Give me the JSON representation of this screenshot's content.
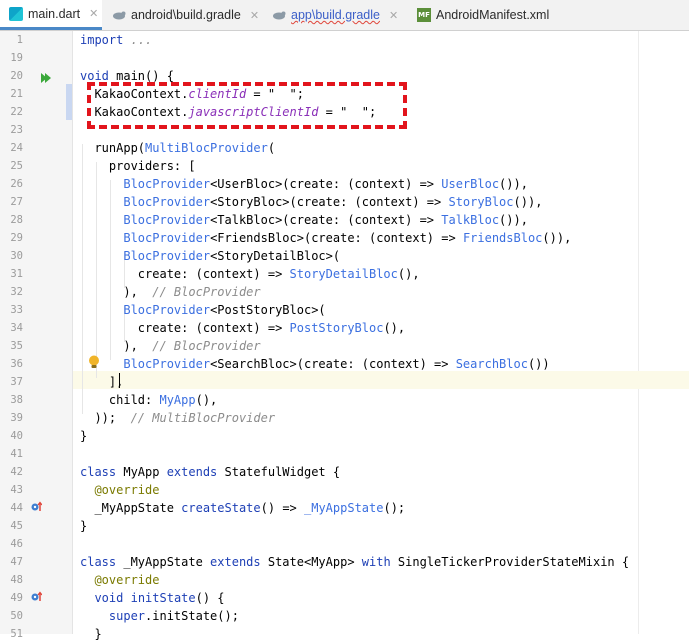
{
  "tabs": [
    {
      "label": "main.dart",
      "icon": "dart-file-icon",
      "active": true
    },
    {
      "label": "android\\build.gradle",
      "icon": "gradle-icon",
      "active": false
    },
    {
      "label": "app\\build.gradle",
      "icon": "gradle-icon",
      "active": false
    },
    {
      "label": "AndroidManifest.xml",
      "icon": "manifest-file-icon",
      "active": false,
      "icon_text": "MF"
    }
  ],
  "editor": {
    "line_numbers": [
      "1",
      "19",
      "20",
      "21",
      "22",
      "23",
      "24",
      "25",
      "26",
      "27",
      "28",
      "29",
      "30",
      "31",
      "32",
      "33",
      "34",
      "35",
      "36",
      "37",
      "38",
      "39",
      "40",
      "41",
      "42",
      "43",
      "44",
      "45",
      "46",
      "47",
      "48",
      "49",
      "50",
      "51"
    ],
    "lines": [
      [
        {
          "t": "kw",
          "s": "import"
        },
        {
          "t": "",
          "s": " "
        },
        {
          "t": "com",
          "s": "..."
        }
      ],
      [],
      [
        {
          "t": "kw",
          "s": "void"
        },
        {
          "t": "",
          "s": " main() {"
        }
      ],
      [
        {
          "t": "",
          "s": "  KakaoContext."
        },
        {
          "t": "fld",
          "s": "clientId"
        },
        {
          "t": "",
          "s": " = \"  \";"
        }
      ],
      [
        {
          "t": "",
          "s": "  KakaoContext."
        },
        {
          "t": "fld",
          "s": "javascriptClientId"
        },
        {
          "t": "",
          "s": " = \"  \";"
        }
      ],
      [],
      [
        {
          "t": "",
          "s": "  runApp("
        },
        {
          "t": "cls",
          "s": "MultiBlocProvider"
        },
        {
          "t": "",
          "s": "("
        }
      ],
      [
        {
          "t": "",
          "s": "    providers: ["
        }
      ],
      [
        {
          "t": "",
          "s": "      "
        },
        {
          "t": "cls",
          "s": "BlocProvider"
        },
        {
          "t": "",
          "s": "<UserBloc>(create: (context) => "
        },
        {
          "t": "cls",
          "s": "UserBloc"
        },
        {
          "t": "",
          "s": "()),"
        }
      ],
      [
        {
          "t": "",
          "s": "      "
        },
        {
          "t": "cls",
          "s": "BlocProvider"
        },
        {
          "t": "",
          "s": "<StoryBloc>(create: (context) => "
        },
        {
          "t": "cls",
          "s": "StoryBloc"
        },
        {
          "t": "",
          "s": "()),"
        }
      ],
      [
        {
          "t": "",
          "s": "      "
        },
        {
          "t": "cls",
          "s": "BlocProvider"
        },
        {
          "t": "",
          "s": "<TalkBloc>(create: (context) => "
        },
        {
          "t": "cls",
          "s": "TalkBloc"
        },
        {
          "t": "",
          "s": "()),"
        }
      ],
      [
        {
          "t": "",
          "s": "      "
        },
        {
          "t": "cls",
          "s": "BlocProvider"
        },
        {
          "t": "",
          "s": "<FriendsBloc>(create: (context) => "
        },
        {
          "t": "cls",
          "s": "FriendsBloc"
        },
        {
          "t": "",
          "s": "()),"
        }
      ],
      [
        {
          "t": "",
          "s": "      "
        },
        {
          "t": "cls",
          "s": "BlocProvider"
        },
        {
          "t": "",
          "s": "<StoryDetailBloc>("
        }
      ],
      [
        {
          "t": "",
          "s": "        create: (context) => "
        },
        {
          "t": "cls",
          "s": "StoryDetailBloc"
        },
        {
          "t": "",
          "s": "(),"
        }
      ],
      [
        {
          "t": "",
          "s": "      ),  "
        },
        {
          "t": "com",
          "s": "// BlocProvider"
        }
      ],
      [
        {
          "t": "",
          "s": "      "
        },
        {
          "t": "cls",
          "s": "BlocProvider"
        },
        {
          "t": "",
          "s": "<PostStoryBloc>("
        }
      ],
      [
        {
          "t": "",
          "s": "        create: (context) => "
        },
        {
          "t": "cls",
          "s": "PostStoryBloc"
        },
        {
          "t": "",
          "s": "(),"
        }
      ],
      [
        {
          "t": "",
          "s": "      ),  "
        },
        {
          "t": "com",
          "s": "// BlocProvider"
        }
      ],
      [
        {
          "t": "",
          "s": "      "
        },
        {
          "t": "cls",
          "s": "BlocProvider"
        },
        {
          "t": "",
          "s": "<SearchBloc>(create: (context) => "
        },
        {
          "t": "cls",
          "s": "SearchBloc"
        },
        {
          "t": "",
          "s": "())"
        }
      ],
      [
        {
          "t": "",
          "s": "    ],"
        }
      ],
      [
        {
          "t": "",
          "s": "    child: "
        },
        {
          "t": "cls",
          "s": "MyApp"
        },
        {
          "t": "",
          "s": "(),"
        }
      ],
      [
        {
          "t": "",
          "s": "  ));  "
        },
        {
          "t": "com",
          "s": "// MultiBlocProvider"
        }
      ],
      [
        {
          "t": "",
          "s": "}"
        }
      ],
      [],
      [
        {
          "t": "kw",
          "s": "class"
        },
        {
          "t": "",
          "s": " MyApp "
        },
        {
          "t": "kw",
          "s": "extends"
        },
        {
          "t": "",
          "s": " StatefulWidget {"
        }
      ],
      [
        {
          "t": "",
          "s": "  "
        },
        {
          "t": "ann",
          "s": "@override"
        }
      ],
      [
        {
          "t": "",
          "s": "  _MyAppState "
        },
        {
          "t": "kw",
          "s": "createState"
        },
        {
          "t": "",
          "s": "() => "
        },
        {
          "t": "cls",
          "s": "_MyAppState"
        },
        {
          "t": "",
          "s": "();"
        }
      ],
      [
        {
          "t": "",
          "s": "}"
        }
      ],
      [],
      [
        {
          "t": "kw",
          "s": "class"
        },
        {
          "t": "",
          "s": " _MyAppState "
        },
        {
          "t": "kw",
          "s": "extends"
        },
        {
          "t": "",
          "s": " State<MyApp> "
        },
        {
          "t": "kw",
          "s": "with"
        },
        {
          "t": "",
          "s": " SingleTickerProviderStateMixin {"
        }
      ],
      [
        {
          "t": "",
          "s": "  "
        },
        {
          "t": "ann",
          "s": "@override"
        }
      ],
      [
        {
          "t": "",
          "s": "  "
        },
        {
          "t": "kw",
          "s": "void"
        },
        {
          "t": "",
          "s": " "
        },
        {
          "t": "kw",
          "s": "initState"
        },
        {
          "t": "",
          "s": "() {"
        }
      ],
      [
        {
          "t": "",
          "s": "    "
        },
        {
          "t": "kw",
          "s": "super"
        },
        {
          "t": "",
          "s": ".initState();"
        }
      ],
      [
        {
          "t": "",
          "s": "  }"
        }
      ]
    ]
  },
  "gutter_icons": {
    "run": "run-icon",
    "override": "override-method-icon",
    "intention": "light-bulb-icon"
  },
  "colors": {
    "annotation_box": "#e2141c",
    "keyword": "#1d3fb5",
    "class_ref": "#3b6fe0",
    "field": "#8a2fb8",
    "comment": "#8c8c8c"
  }
}
